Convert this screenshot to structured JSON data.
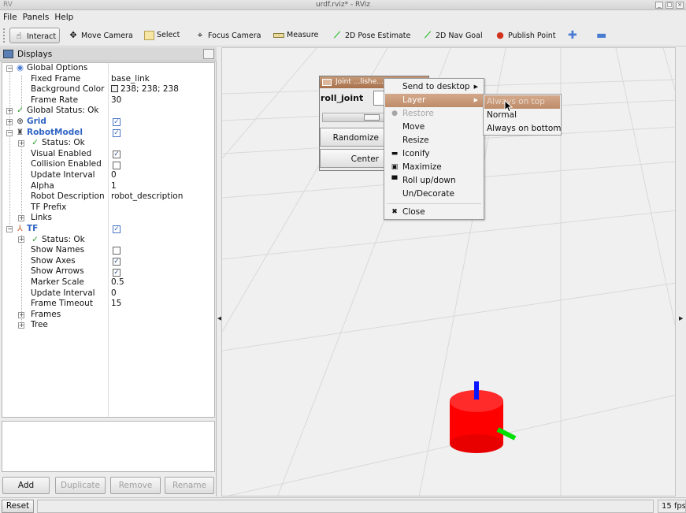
{
  "window": {
    "title": "urdf.rviz* - RViz",
    "logo": "RV"
  },
  "menubar": [
    "File",
    "Panels",
    "Help"
  ],
  "toolbar": {
    "interact": "Interact",
    "move_camera": "Move Camera",
    "select": "Select",
    "focus_camera": "Focus Camera",
    "measure": "Measure",
    "pose_estimate": "2D Pose Estimate",
    "nav_goal": "2D Nav Goal",
    "publish_point": "Publish Point"
  },
  "displays": {
    "title": "Displays",
    "rows": [
      {
        "label": "Global Options",
        "value": ""
      },
      {
        "label": "Fixed Frame",
        "value": "base_link"
      },
      {
        "label": "Background Color",
        "value": "238; 238; 238"
      },
      {
        "label": "Frame Rate",
        "value": "30"
      },
      {
        "label": "Global Status: Ok",
        "value": ""
      },
      {
        "label": "Grid",
        "value": ""
      },
      {
        "label": "RobotModel",
        "value": ""
      },
      {
        "label": "Status: Ok",
        "value": ""
      },
      {
        "label": "Visual Enabled",
        "value": ""
      },
      {
        "label": "Collision Enabled",
        "value": ""
      },
      {
        "label": "Update Interval",
        "value": "0"
      },
      {
        "label": "Alpha",
        "value": "1"
      },
      {
        "label": "Robot Description",
        "value": "robot_description"
      },
      {
        "label": "TF Prefix",
        "value": ""
      },
      {
        "label": "Links",
        "value": ""
      },
      {
        "label": "TF",
        "value": ""
      },
      {
        "label": "Status: Ok",
        "value": ""
      },
      {
        "label": "Show Names",
        "value": ""
      },
      {
        "label": "Show Axes",
        "value": ""
      },
      {
        "label": "Show Arrows",
        "value": ""
      },
      {
        "label": "Marker Scale",
        "value": "0.5"
      },
      {
        "label": "Update Interval",
        "value": "0"
      },
      {
        "label": "Frame Timeout",
        "value": "15"
      },
      {
        "label": "Frames",
        "value": ""
      },
      {
        "label": "Tree",
        "value": ""
      }
    ],
    "buttons": {
      "add": "Add",
      "duplicate": "Duplicate",
      "remove": "Remove",
      "rename": "Rename"
    }
  },
  "joint_window": {
    "title": "Joint ...lishe...",
    "joint_label": "roll_joint",
    "randomize": "Randomize",
    "center": "Center"
  },
  "context_menu": {
    "items": [
      "Send to desktop",
      "Layer",
      "Restore",
      "Move",
      "Resize",
      "Iconify",
      "Maximize",
      "Roll up/down",
      "Un/Decorate",
      "Close"
    ],
    "layer_submenu": [
      "Always on top",
      "Normal",
      "Always on bottom"
    ]
  },
  "statusbar": {
    "reset": "Reset",
    "fps": "15 fps"
  },
  "colors": {
    "accent": "#2f63c3",
    "menu_highlight": "#c4916e",
    "cylinder": "#ff0000",
    "axis_z": "#0000ff",
    "axis_y": "#00dd00"
  }
}
